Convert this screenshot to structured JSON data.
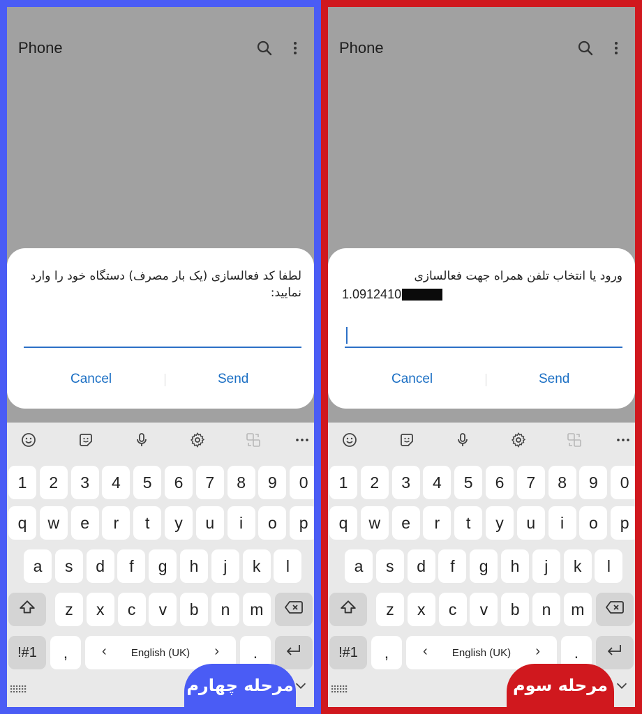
{
  "panels": {
    "left": {
      "app_title": "Phone",
      "message": "لطفا کد فعالسازی (یک بار مصرف) دستگاه خود را وارد نمایید:",
      "cancel_label": "Cancel",
      "send_label": "Send",
      "badge": "مرحله چهارم",
      "badge_color": "#4a5cf5",
      "frame_color": "#4a5cf5"
    },
    "right": {
      "app_title": "Phone",
      "message": "ورود یا انتخاب تلفن همراه جهت فعالسازی",
      "number": "1.0912410",
      "cancel_label": "Cancel",
      "send_label": "Send",
      "badge": "مرحله سوم",
      "badge_color": "#d0181e",
      "frame_color": "#d0181e"
    }
  },
  "keyboard": {
    "toolbar_icons": [
      "emoji-icon",
      "sticker-icon",
      "microphone-icon",
      "settings-icon",
      "translate-icon",
      "more-icon"
    ],
    "row_numbers": [
      "1",
      "2",
      "3",
      "4",
      "5",
      "6",
      "7",
      "8",
      "9",
      "0"
    ],
    "row_q": [
      "q",
      "w",
      "e",
      "r",
      "t",
      "y",
      "u",
      "i",
      "o",
      "p"
    ],
    "row_a": [
      "a",
      "s",
      "d",
      "f",
      "g",
      "h",
      "j",
      "k",
      "l"
    ],
    "row_z": [
      "z",
      "x",
      "c",
      "v",
      "b",
      "n",
      "m"
    ],
    "symbols_label": "!#1",
    "comma_label": ",",
    "space_label": "English (UK)",
    "period_label": "."
  }
}
